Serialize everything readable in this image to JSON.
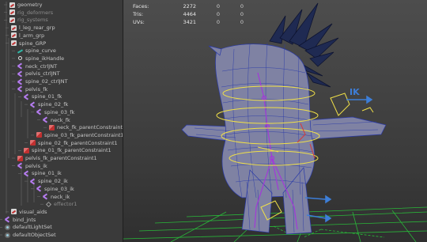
{
  "outliner": {
    "items": [
      {
        "label": "geometry",
        "icon": "group-icon",
        "dim": false
      },
      {
        "label": "rig_deformers",
        "icon": "group-icon",
        "dim": true
      },
      {
        "label": "rig_systems",
        "icon": "group-icon",
        "dim": true
      },
      {
        "label": "l_leg_rear_grp",
        "icon": "group-icon",
        "dim": false
      },
      {
        "label": "l_arm_grp",
        "icon": "group-icon",
        "dim": false
      },
      {
        "label": "spine_GRP",
        "icon": "group-icon",
        "dim": false
      },
      {
        "label": "spine_curve",
        "icon": "curve-icon",
        "dim": false
      },
      {
        "label": "spine_ikHandle",
        "icon": "ik-handle-icon",
        "dim": false
      },
      {
        "label": "neck_ctrlJNT",
        "icon": "joint-icon",
        "dim": false
      },
      {
        "label": "pelvis_ctrlJNT",
        "icon": "joint-icon",
        "dim": false
      },
      {
        "label": "spine_02_ctrlJNT",
        "icon": "joint-icon",
        "dim": false
      },
      {
        "label": "pelvis_fk",
        "icon": "joint-icon",
        "dim": false
      },
      {
        "label": "spine_01_fk",
        "icon": "joint-icon",
        "dim": false
      },
      {
        "label": "spine_02_fk",
        "icon": "joint-icon",
        "dim": false
      },
      {
        "label": "spine_03_fk",
        "icon": "joint-icon",
        "dim": false
      },
      {
        "label": "neck_fk",
        "icon": "joint-icon",
        "dim": false
      },
      {
        "label": "neck_fk_parentConstraint1",
        "icon": "constraint-icon",
        "dim": false
      },
      {
        "label": "spine_03_fk_parentConstraint1",
        "icon": "constraint-icon",
        "dim": false
      },
      {
        "label": "spine_02_fk_parentConstraint1",
        "icon": "constraint-icon",
        "dim": false
      },
      {
        "label": "spine_01_fk_parentConstraint1",
        "icon": "constraint-icon",
        "dim": false
      },
      {
        "label": "pelvis_fk_parentConstraint1",
        "icon": "constraint-icon",
        "dim": false
      },
      {
        "label": "pelvis_ik",
        "icon": "joint-icon",
        "dim": false
      },
      {
        "label": "spine_01_ik",
        "icon": "joint-icon",
        "dim": false
      },
      {
        "label": "spine_02_ik",
        "icon": "joint-icon",
        "dim": false
      },
      {
        "label": "spine_03_ik",
        "icon": "joint-icon",
        "dim": false
      },
      {
        "label": "neck_ik",
        "icon": "joint-icon",
        "dim": false
      },
      {
        "label": "effector1",
        "icon": "effector-icon",
        "dim": true
      },
      {
        "label": "visual_aids",
        "icon": "group-icon",
        "dim": false
      },
      {
        "label": "bind_jnts",
        "icon": "joint-icon",
        "dim": false
      },
      {
        "label": "defaultLightSet",
        "icon": "set-icon",
        "dim": false
      },
      {
        "label": "defaultObjectSet",
        "icon": "set-icon",
        "dim": false
      }
    ]
  },
  "hud": {
    "rows": [
      {
        "label": "Faces:",
        "value": "2272",
        "z1": "0",
        "z2": "0"
      },
      {
        "label": "Tris:",
        "value": "4464",
        "z1": "0",
        "z2": "0"
      },
      {
        "label": "UVs:",
        "value": "3421",
        "z1": "0",
        "z2": "0"
      }
    ]
  },
  "viewport": {
    "ik_label": "IK",
    "colors": {
      "mesh_fill": "#7f82a3",
      "wire": "#2a3aa8",
      "control_yellow": "#f0e048",
      "grid_green": "#29c63a",
      "joint_purple": "#a23ad8",
      "ik_blue": "#3d7ed8"
    }
  }
}
